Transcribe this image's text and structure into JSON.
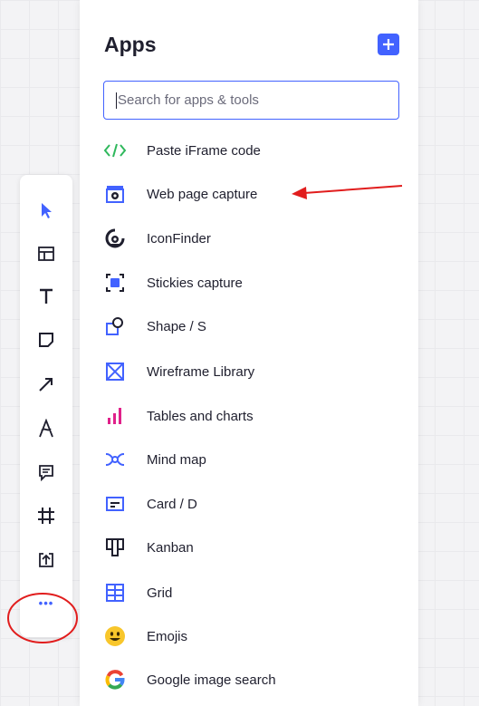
{
  "panel": {
    "title": "Apps",
    "add_button_label": "+",
    "search_placeholder": "Search for apps & tools"
  },
  "apps": [
    {
      "label": "Paste iFrame code",
      "icon": "code-icon"
    },
    {
      "label": "Web page capture",
      "icon": "webpage-capture-icon"
    },
    {
      "label": "IconFinder",
      "icon": "iconfinder-icon"
    },
    {
      "label": "Stickies capture",
      "icon": "stickies-capture-icon"
    },
    {
      "label": "Shape / S",
      "icon": "shape-icon"
    },
    {
      "label": "Wireframe Library",
      "icon": "wireframe-icon"
    },
    {
      "label": "Tables and charts",
      "icon": "bar-chart-icon"
    },
    {
      "label": "Mind map",
      "icon": "mind-map-icon"
    },
    {
      "label": "Card / D",
      "icon": "card-icon"
    },
    {
      "label": "Kanban",
      "icon": "kanban-icon"
    },
    {
      "label": "Grid",
      "icon": "grid-icon"
    },
    {
      "label": "Emojis",
      "icon": "emoji-icon"
    },
    {
      "label": "Google image search",
      "icon": "google-icon"
    }
  ],
  "toolbar": {
    "tools": [
      "select-cursor-icon",
      "templates-icon",
      "text-icon",
      "sticky-note-icon",
      "arrow-icon",
      "pen-icon",
      "comment-icon",
      "frame-icon",
      "upload-icon",
      "more-icon"
    ],
    "more_label": "•••"
  },
  "colors": {
    "accent": "#4262ff",
    "annotation": "#e11d1d"
  }
}
